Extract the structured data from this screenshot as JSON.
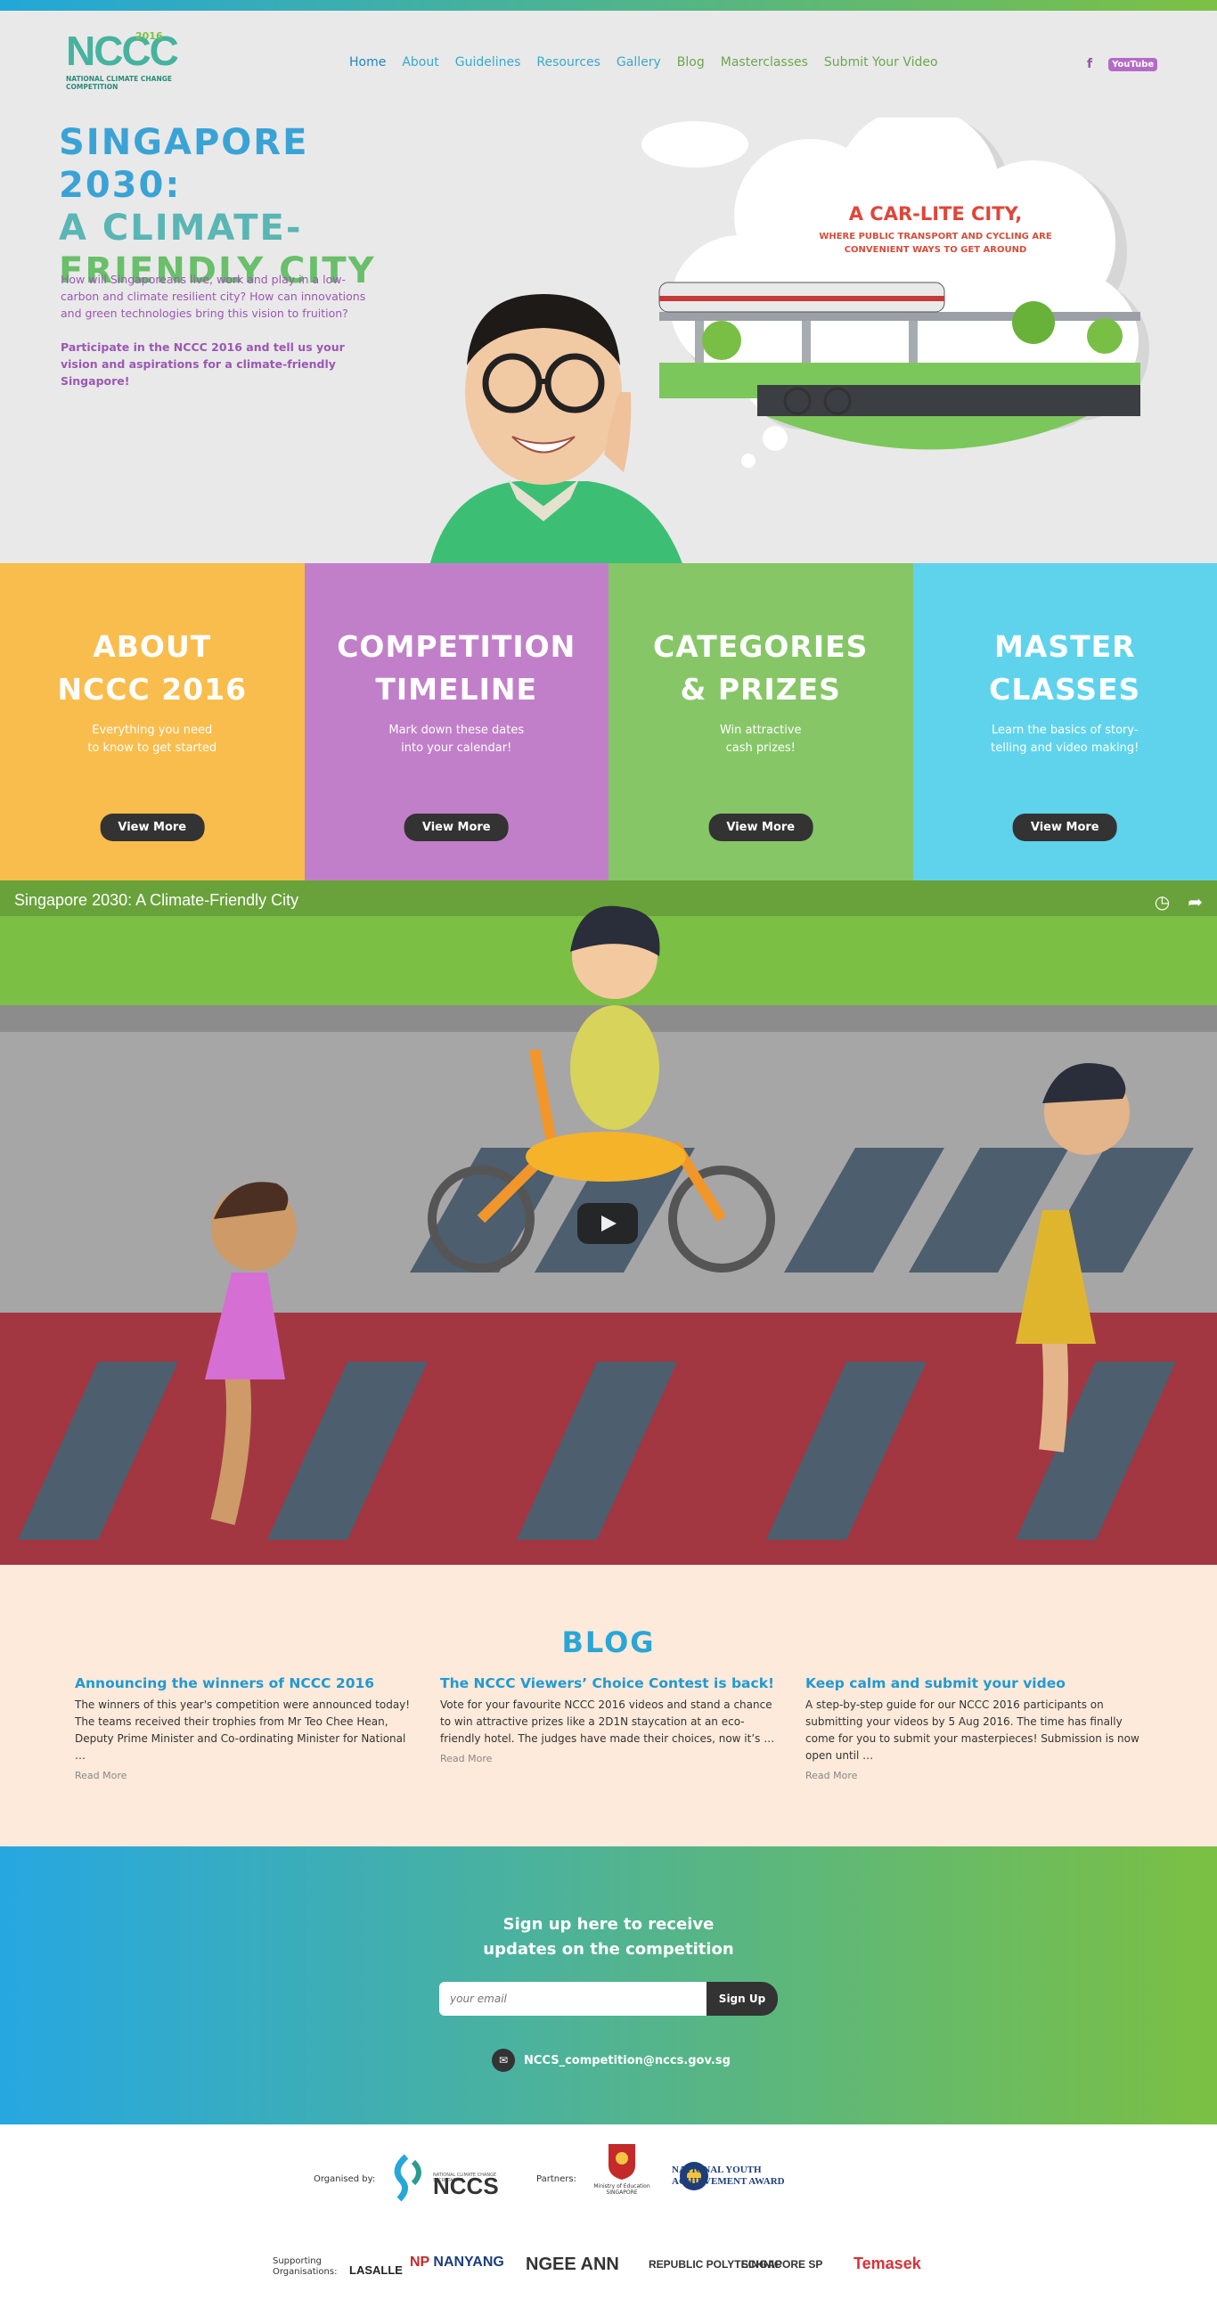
{
  "logo": {
    "mark": "NCCC",
    "year": "2016",
    "subtitle": "NATIONAL CLIMATE CHANGE COMPETITION"
  },
  "nav": [
    "Home",
    "About",
    "Guidelines",
    "Resources",
    "Gallery",
    "Blog",
    "Masterclasses",
    "Submit Your Video"
  ],
  "social": {
    "facebook": "f",
    "youtube": "YouTube"
  },
  "hero": {
    "title_lines": [
      "SINGAPORE 2030:",
      "A CLIMATE-",
      "FRIENDLY CITY"
    ],
    "description": "How will Singaporeans live, work and play in a low-carbon and climate resilient city? How can innovations and green technologies bring this vision to fruition?",
    "cta": "Participate in the NCCC 2016 and tell us your vision and aspirations for a climate-friendly Singapore!",
    "cloud_title": "A CAR-LITE CITY,",
    "cloud_sub": "WHERE PUBLIC TRANSPORT AND CYCLING ARE CONVENIENT WAYS TO GET AROUND"
  },
  "tiles": [
    {
      "title_l1": "ABOUT",
      "title_l2": "NCCC 2016",
      "line1": "Everything you need",
      "line2": "to know to get started",
      "button": "View More",
      "color": "#f9bd4d"
    },
    {
      "title_l1": "COMPETITION",
      "title_l2": "TIMELINE",
      "line1": "Mark down these dates",
      "line2": "into your calendar!",
      "button": "View More",
      "color": "#c17fc9"
    },
    {
      "title_l1": "CATEGORIES",
      "title_l2": "& PRIZES",
      "line1": "Win attractive",
      "line2": "cash prizes!",
      "button": "View More",
      "color": "#86c667"
    },
    {
      "title_l1": "MASTER",
      "title_l2": "CLASSES",
      "line1": "Learn the basics of story-",
      "line2": "telling and video making!",
      "button": "View More",
      "color": "#5fd3ec"
    }
  ],
  "video": {
    "title": "Singapore 2030: A Climate-Friendly City",
    "icon_watch": "watch-later-icon",
    "icon_share": "share-icon"
  },
  "blog": {
    "heading": "BLOG",
    "posts": [
      {
        "title": "Announcing the winners of NCCC 2016",
        "excerpt": "The winners of this year's competition were announced today! The teams received their trophies from Mr Teo Chee Hean, Deputy Prime Minister and Co-ordinating Minister for National …",
        "more": "Read More"
      },
      {
        "title": "The NCCC Viewers’ Choice Contest is back!",
        "excerpt": "Vote for your favourite NCCC 2016 videos and stand a chance to win attractive prizes like a 2D1N staycation at an eco-friendly hotel. The judges have made their choices, now it’s …",
        "more": "Read More"
      },
      {
        "title": "Keep calm and submit your video",
        "excerpt": "A step-by-step guide for our NCCC 2016 participants on submitting your videos by 5 Aug 2016. The time has finally come for you to submit your masterpieces! Submission is now open until …",
        "more": "Read More"
      }
    ]
  },
  "signup": {
    "line1": "Sign up here to receive",
    "line2": "updates on the competition",
    "placeholder": "your email",
    "button": "Sign Up",
    "email": "NCCS_competition@nccs.gov.sg"
  },
  "partners": {
    "organised_by": "Organised by:",
    "nccs": "NCCS",
    "nccs_sub": "NATIONAL CLIMATE CHANGE SECRETARIAT",
    "partners_label": "Partners:",
    "moe": "Ministry of Education SINGAPORE",
    "nyaa": "NATIONAL YOUTH ACHIEVEMENT AWARD",
    "supporting_l1": "Supporting",
    "supporting_l2": "Organisations:",
    "orgs": [
      "LASALLE",
      "NANYANG",
      "NGEE ANN",
      "REPUBLIC POLYTECHNIC",
      "SINGAPORE SP",
      "Temasek"
    ]
  }
}
